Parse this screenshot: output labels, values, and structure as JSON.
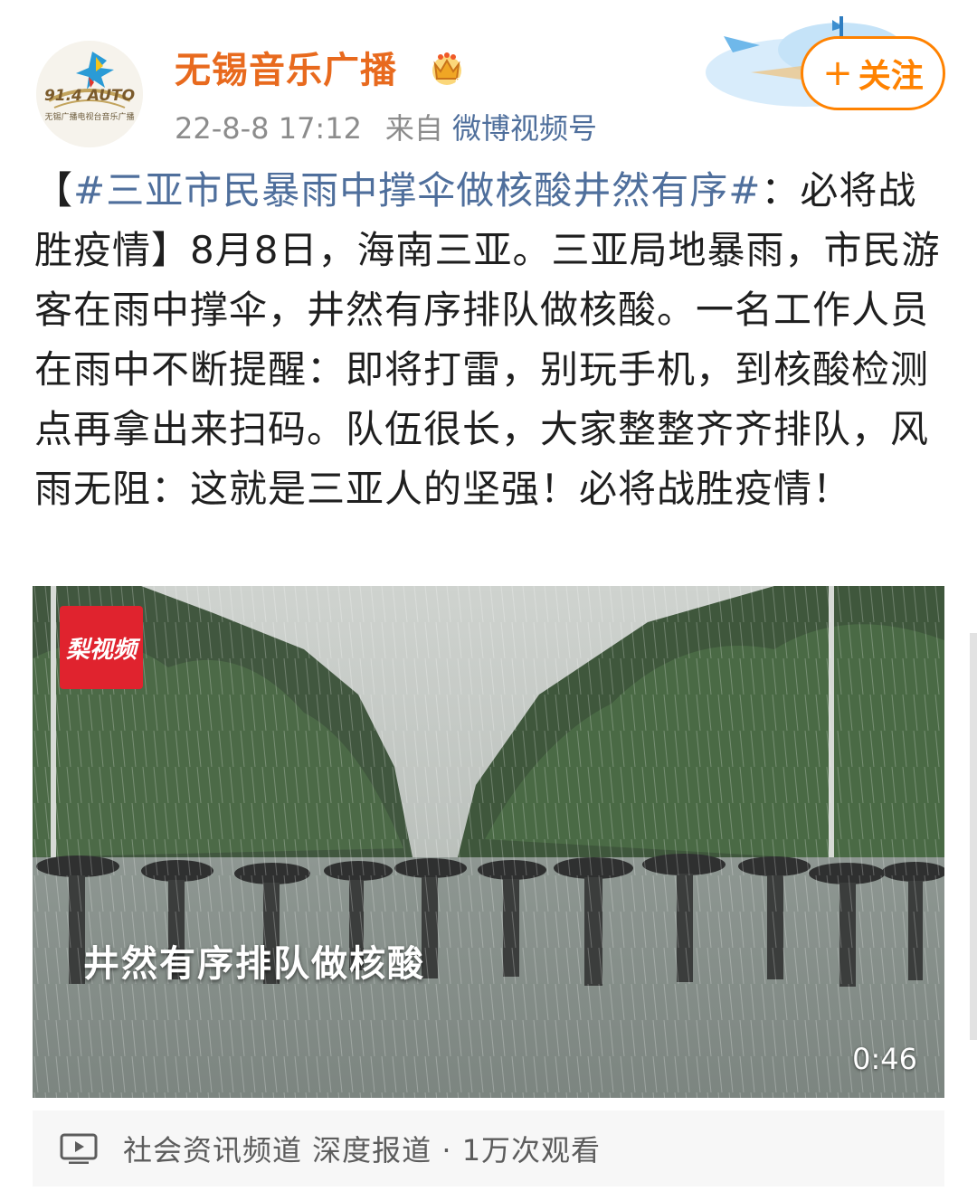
{
  "header": {
    "account_name": "无锡音乐广播",
    "avatar_text": "91.4 AUTO",
    "avatar_subtext": "无锡广播电视台音乐广播",
    "timestamp": "22-8-8 17:12",
    "source_prefix": "来自",
    "source_name": "微博视频号",
    "follow_label": "关注",
    "follow_icon": "+"
  },
  "post": {
    "open_bracket": "【",
    "topic": "#三亚市民暴雨中撑伞做核酸井然有序#",
    "body": "：必将战胜疫情】8月8日，海南三亚。三亚局地暴雨，市民游客在雨中撑伞，井然有序排队做核酸。一名工作人员在雨中不断提醒：即将打雷，别玩手机，到核酸检测点再拿出来扫码。队伍很长，大家整整齐齐排队，风雨无阻：这就是三亚人的坚强！必将战胜疫情！"
  },
  "video": {
    "logo_text": "梨视频",
    "caption": "井然有序排队做核酸",
    "duration": "0:46"
  },
  "footer": {
    "icon": "video-play-icon",
    "info": "社会资讯频道 深度报道 · 1万次观看"
  },
  "colors": {
    "name": "#e86a1e",
    "topic": "#4f6f9c",
    "follow": "#ff8200",
    "badge_red": "#e0232e"
  }
}
